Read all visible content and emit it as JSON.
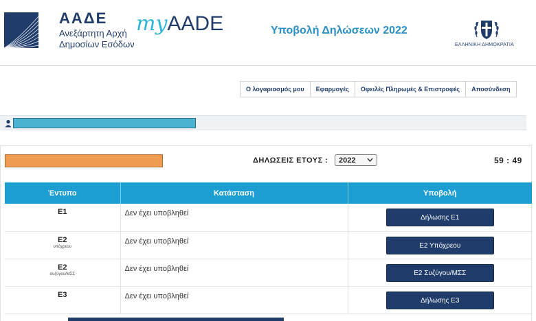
{
  "header": {
    "aade_title": "ΑΑΔΕ",
    "aade_subtitle_1": "Ανεξάρτητη Αρχή",
    "aade_subtitle_2": "Δημοσίων Εσόδων",
    "myaade_my": "my",
    "myaade_aade": "AADE",
    "page_title": "Υποβολή Δηλώσεων 2022",
    "gov_label": "ΕΛΛΗΝΙΚΗ ΔΗΜΟΚΡΑΤΙΑ"
  },
  "nav": {
    "items": [
      "Ο λογαριασμός μου",
      "Εφαρμογές",
      "Οφειλές Πληρωμές & Επιστροφές",
      "Αποσύνδεση"
    ]
  },
  "filter": {
    "year_label": "ΔΗΛΩΣΕΙΣ ΕΤΟΥΣ :",
    "year_value": "2022",
    "timer": "59 : 49"
  },
  "table": {
    "headers": [
      "Έντυπο",
      "Κατάσταση",
      "Υποβολή"
    ],
    "rows": [
      {
        "form": "E1",
        "sub": "",
        "status": "Δεν έχει υποβληθεί",
        "button": "Δήλωσης Ε1"
      },
      {
        "form": "E2",
        "sub": "υπόχρεου",
        "status": "Δεν έχει υποβληθεί",
        "button": "Ε2 Υπόχρεου"
      },
      {
        "form": "E2",
        "sub": "συζύγου/ΜΣΣ",
        "status": "Δεν έχει υποβληθεί",
        "button": "Ε2 Συζύγου/ΜΣΣ"
      },
      {
        "form": "E3",
        "sub": "",
        "status": "Δεν έχει υποβληθεί",
        "button": "Δήλωσης Ε3"
      }
    ]
  },
  "colors": {
    "navy": "#1f3c6b",
    "table_header": "#1c9ed3",
    "title_blue": "#2a8fc4",
    "redacted_user": "#4bb3cf",
    "redacted_orange": "#ef9b52"
  },
  "icons": [
    "aade-logo-icon",
    "greek-emblem-icon",
    "user-icon",
    "chevron-down-icon"
  ]
}
